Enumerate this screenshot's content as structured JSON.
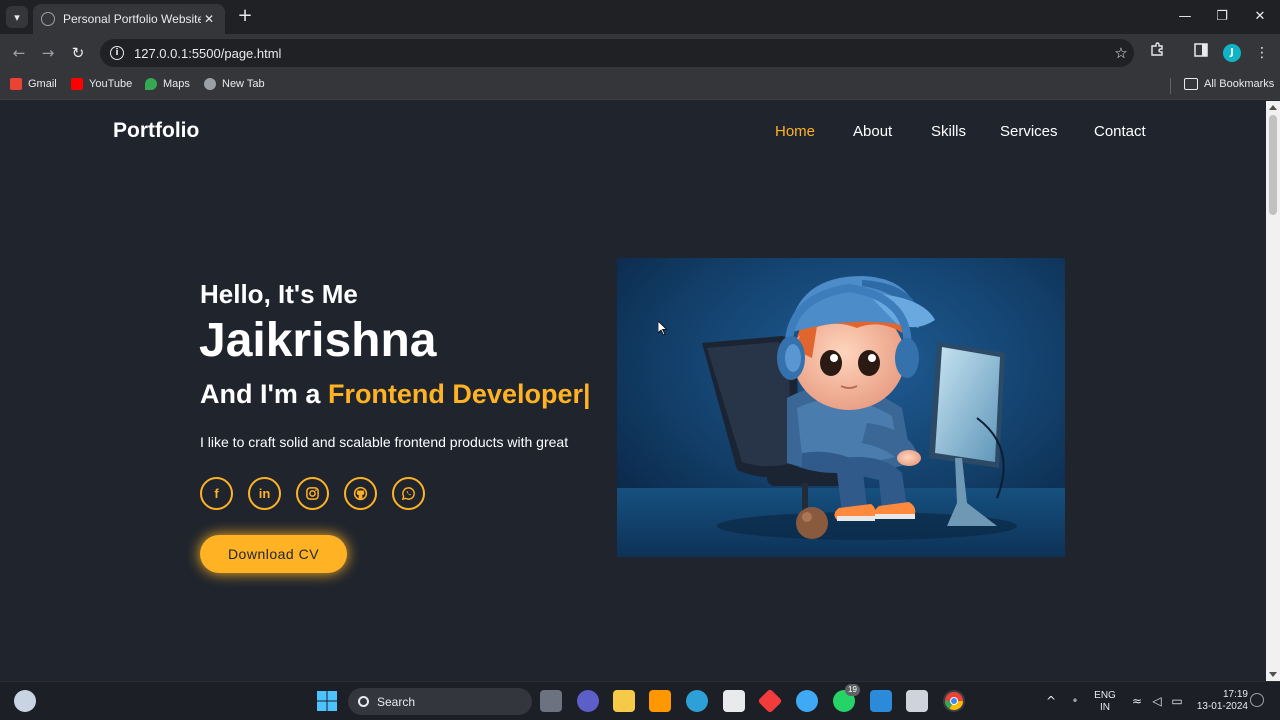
{
  "browser": {
    "tab_title": "Personal Portfolio Website",
    "url": "127.0.0.1:5500/page.html",
    "new_tab_symbol": "+",
    "profile_initial": "J",
    "bookmarks": [
      {
        "label": "Gmail",
        "color": "#ea4335"
      },
      {
        "label": "YouTube",
        "color": "#ff0000"
      },
      {
        "label": "Maps",
        "color": "#34a853"
      },
      {
        "label": "New Tab",
        "color": "#9aa0a6"
      }
    ],
    "all_bookmarks": "All Bookmarks"
  },
  "page": {
    "logo": "Portfolio",
    "nav": [
      "Home",
      "About",
      "Skills",
      "Services",
      "Contact"
    ],
    "active_nav": "Home",
    "hello": "Hello, It's Me",
    "name": "Jaikrishna",
    "role_prefix": "And I'm a ",
    "role_accent": "Frontend Developer|",
    "description": "I like to craft solid and scalable frontend products with great",
    "social": [
      "facebook-icon",
      "linkedin-icon",
      "instagram-icon",
      "github-icon",
      "whatsapp-icon"
    ],
    "linkedin_text": "in",
    "facebook_text": "f",
    "cv_button": "Download CV",
    "accent_color": "#ffb224",
    "background_color": "#1f242d"
  },
  "taskbar": {
    "search_label": "Search",
    "whatsapp_badge": "19",
    "lang_top": "ENG",
    "lang_bottom": "IN",
    "time": "17:19",
    "date": "13-01-2024"
  }
}
